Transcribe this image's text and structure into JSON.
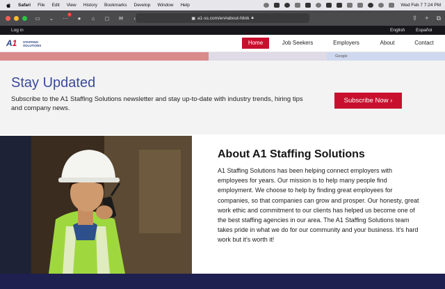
{
  "menubar": {
    "app": "Safari",
    "items": [
      "File",
      "Edit",
      "View",
      "History",
      "Bookmarks",
      "Develop",
      "Window",
      "Help"
    ],
    "datetime": "Wed Feb 7  7:24 PM"
  },
  "browser": {
    "url": "a1-ss.com/en#about-hlink",
    "badge_count": "2"
  },
  "topbar": {
    "login": "Log in",
    "lang_en": "English",
    "lang_es": "Español"
  },
  "nav": {
    "logo_mark": "A",
    "logo_mark_accent": "1",
    "logo_line1": "STAFFING",
    "logo_line2": "SOLUTIONS",
    "items": [
      "Home",
      "Job Seekers",
      "Employers",
      "About",
      "Contact"
    ]
  },
  "map": {
    "google_label": "Google"
  },
  "stay": {
    "title": "Stay Updated",
    "text": "Subscribe to the A1 Staffing Solutions newsletter and stay up-to-date with industry trends, hiring tips and company news.",
    "button": "Subscribe Now  ›"
  },
  "about": {
    "title": "About A1 Staffing Solutions",
    "text": "A1 Staffing Solutions has been helping connect employers with employees for years. Our mission is to help many people find employment. We choose to help by finding great employees for companies, so that companies can grow and prosper. Our honesty, great work ethic and commitment to our clients has helped us become one of the best staffing agencies in our area. The A1 Staffing Solutions team takes pride in what we do for our community and your business. It's hard work but it's worth it!"
  },
  "colors": {
    "brand_red": "#c8102e",
    "brand_blue": "#3a4a9a",
    "footer_navy": "#1e2050"
  }
}
